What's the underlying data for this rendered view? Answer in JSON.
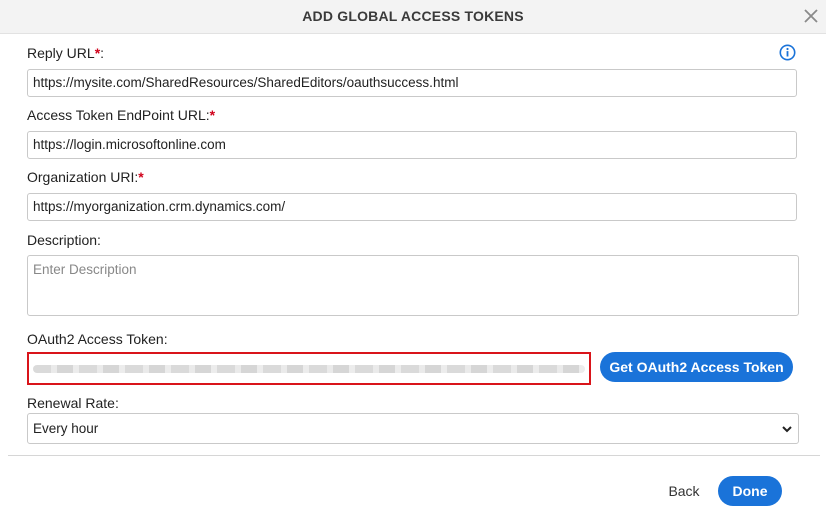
{
  "dialog": {
    "title": "ADD GLOBAL ACCESS TOKENS",
    "close_icon": "close-icon"
  },
  "fields": {
    "reply_url": {
      "label": "Reply URL",
      "required_mark": "*",
      "colon": ":",
      "value": "https://mysite.com/SharedResources/SharedEditors/oauthsuccess.html"
    },
    "access_token_endpoint": {
      "label": "Access Token EndPoint URL:",
      "required_mark": "*",
      "value": "https://login.microsoftonline.com"
    },
    "organization_uri": {
      "label": "Organization URI:",
      "required_mark": "*",
      "value": "https://myorganization.crm.dynamics.com/"
    },
    "description": {
      "label": "Description:",
      "placeholder": "Enter Description",
      "value": ""
    },
    "oauth2_token": {
      "label": "OAuth2 Access Token:",
      "button_label": "Get OAuth2 Access Token"
    },
    "renewal_rate": {
      "label": "Renewal Rate:",
      "selected": "Every hour"
    }
  },
  "footer": {
    "back_label": "Back",
    "done_label": "Done"
  },
  "colors": {
    "accent": "#1a73d9",
    "required": "#d0021b",
    "highlight_border": "#d9141a"
  },
  "icons": {
    "info": "info-icon",
    "dropdown": "chevron-down-icon"
  }
}
